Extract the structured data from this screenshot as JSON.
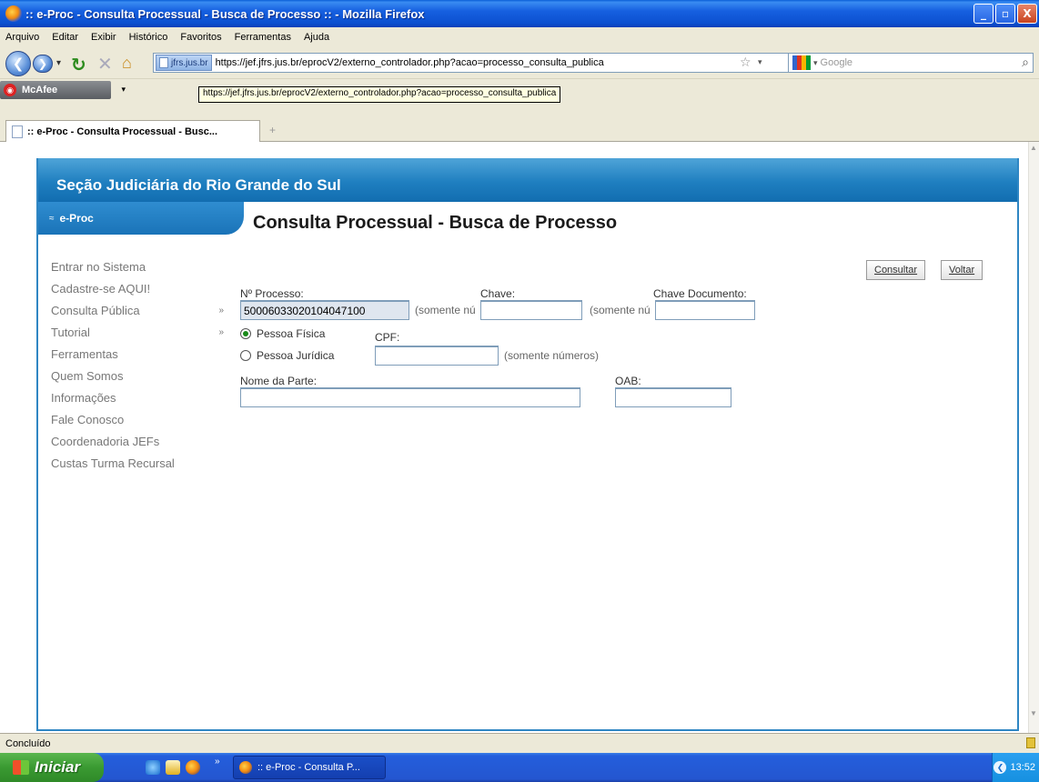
{
  "window": {
    "title": ":: e-Proc - Consulta Processual - Busca de Processo :: - Mozilla Firefox",
    "minimize": "_",
    "maximize": "▫",
    "close": "X"
  },
  "menu": [
    "Arquivo",
    "Editar",
    "Exibir",
    "Histórico",
    "Favoritos",
    "Ferramentas",
    "Ajuda"
  ],
  "navbar": {
    "site_identity": "jfrs.jus.br",
    "url": "https://jef.jfrs.jus.br/eprocV2/externo_controlador.php?acao=processo_consulta_publica",
    "search_placeholder": "Google"
  },
  "addon": {
    "name": "McAfee",
    "url_tooltip": "https://jef.jfrs.jus.br/eprocV2/externo_controlador.php?acao=processo_consulta_publica"
  },
  "tab": {
    "title": ":: e-Proc - Consulta Processual - Busc...",
    "new_tab": "+"
  },
  "page": {
    "site_title": "Seção Judiciária do Rio Grande do Sul",
    "system_name": "e-Proc",
    "heading": "Consulta Processual - Busca de Processo",
    "sidebar": [
      {
        "label": "Entrar no Sistema",
        "arrow": ""
      },
      {
        "label": "Cadastre-se AQUI!",
        "arrow": ""
      },
      {
        "label": "Consulta Pública",
        "arrow": "»"
      },
      {
        "label": "Tutorial",
        "arrow": "»"
      },
      {
        "label": "Ferramentas",
        "arrow": ""
      },
      {
        "label": "Quem Somos",
        "arrow": ""
      },
      {
        "label": "Informações",
        "arrow": ""
      },
      {
        "label": "Fale Conosco",
        "arrow": ""
      },
      {
        "label": "Coordenadoria JEFs",
        "arrow": ""
      },
      {
        "label": "Custas Turma Recursal",
        "arrow": ""
      }
    ],
    "buttons": {
      "consultar": "Consultar",
      "voltar": "Voltar"
    },
    "form": {
      "processo_label": "Nº Processo:",
      "processo_value": "50006033020104047100",
      "processo_hint": "(somente nú",
      "chave_label": "Chave:",
      "chave_value": "",
      "chave_hint": "(somente nú",
      "chave_doc_label": "Chave Documento:",
      "chave_doc_value": "",
      "pessoa_fisica": "Pessoa Física",
      "pessoa_juridica": "Pessoa Jurídica",
      "cpf_label": "CPF:",
      "cpf_value": "",
      "cpf_hint": "(somente números)",
      "nome_parte_label": "Nome da Parte:",
      "nome_parte_value": "",
      "oab_label": "OAB:",
      "oab_value": ""
    }
  },
  "status": "Concluído",
  "taskbar": {
    "start": "Iniciar",
    "task_title": ":: e-Proc - Consulta P...",
    "clock": "13:52"
  },
  "colors": {
    "header_blue": "#1f7fc0",
    "frame_border": "#2f86c3",
    "xp_titlebar": "#0c50d0"
  }
}
